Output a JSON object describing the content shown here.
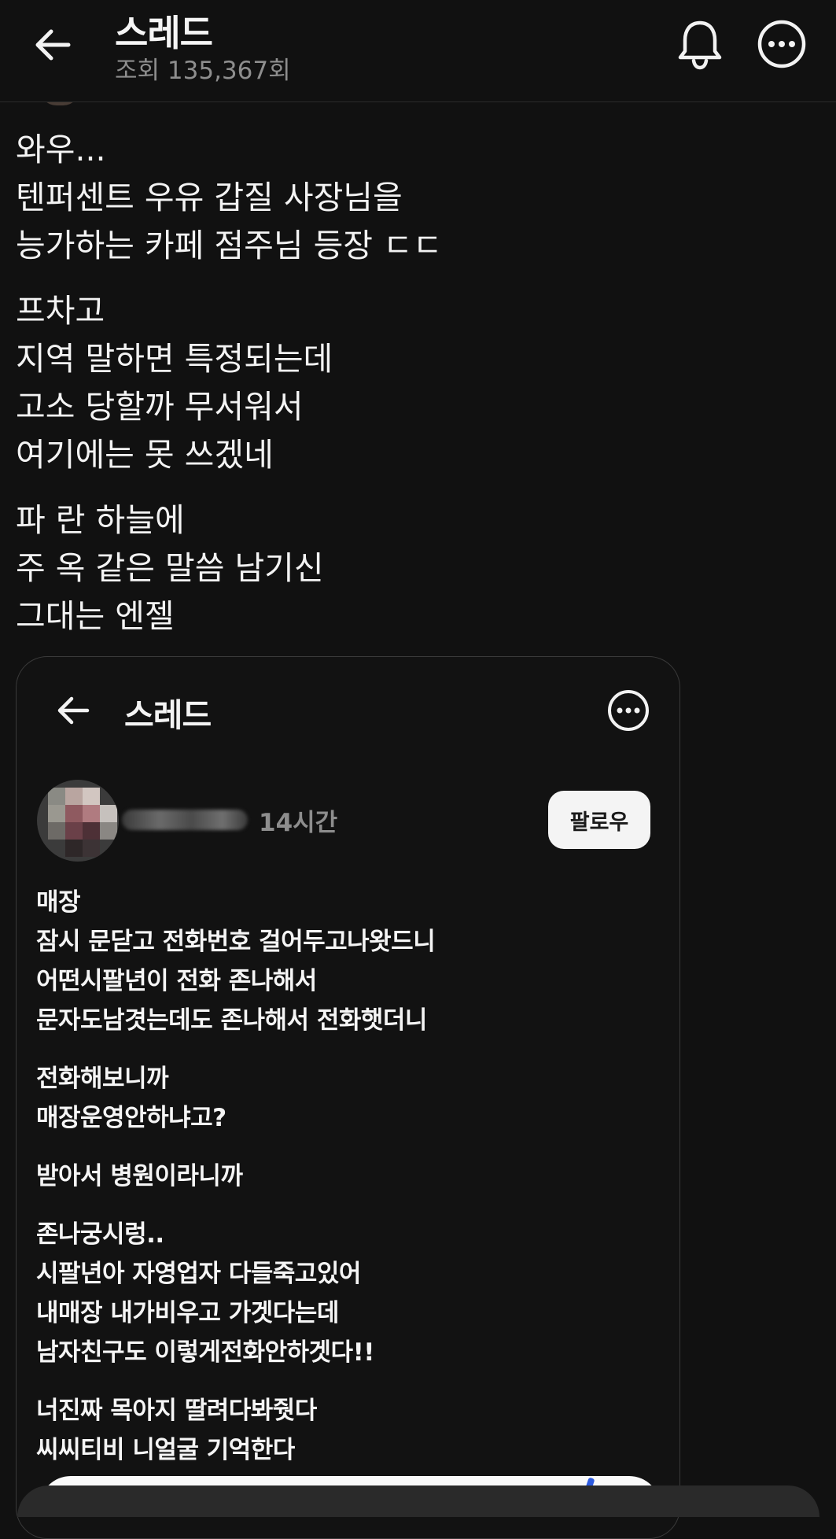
{
  "header": {
    "title": "스레드",
    "views": "조회 135,367회"
  },
  "post": {
    "paragraphs": [
      [
        "와우...",
        "텐퍼센트 우유 갑질 사장님을",
        "능가하는 카페 점주님 등장 ㄷㄷ"
      ],
      [
        "프차고",
        "지역 말하면 특정되는데",
        "고소 당할까 무서워서",
        "여기에는 못 쓰겠네"
      ],
      [
        "파 란 하늘에",
        "주 옥 같은 말씀 남기신",
        "그대는 엔젤"
      ]
    ]
  },
  "embed": {
    "title": "스레드",
    "time": "14시간",
    "follow_label": "팔로우",
    "paragraphs": [
      [
        "매장",
        "잠시 문닫고 전화번호 걸어두고나왓드니",
        "어떤시팔년이 전화 존나해서",
        "문자도남겻는데도 존나해서 전화햇더니"
      ],
      [
        "전화해보니까",
        "매장운영안하냐고?"
      ],
      [
        "받아서 병원이라니까"
      ],
      [
        "존나궁시렁..",
        "시팔년아 자영업자 다들죽고있어",
        "내매장 내가비우고 가겟다는데",
        "남자친구도 이렇게전화안하겟다!!"
      ],
      [
        "너진짜 목아지 딸려다봐줫다",
        "씨씨티비 니얼굴 기억한다"
      ]
    ]
  },
  "icons": {
    "back": "arrow-left-icon",
    "bell": "bell-icon",
    "more": "more-horizontal-icon"
  },
  "colors": {
    "background": "#111111",
    "text": "#f3f3f3",
    "muted": "#8e8e8e",
    "follow_bg": "#f4f4f4"
  }
}
